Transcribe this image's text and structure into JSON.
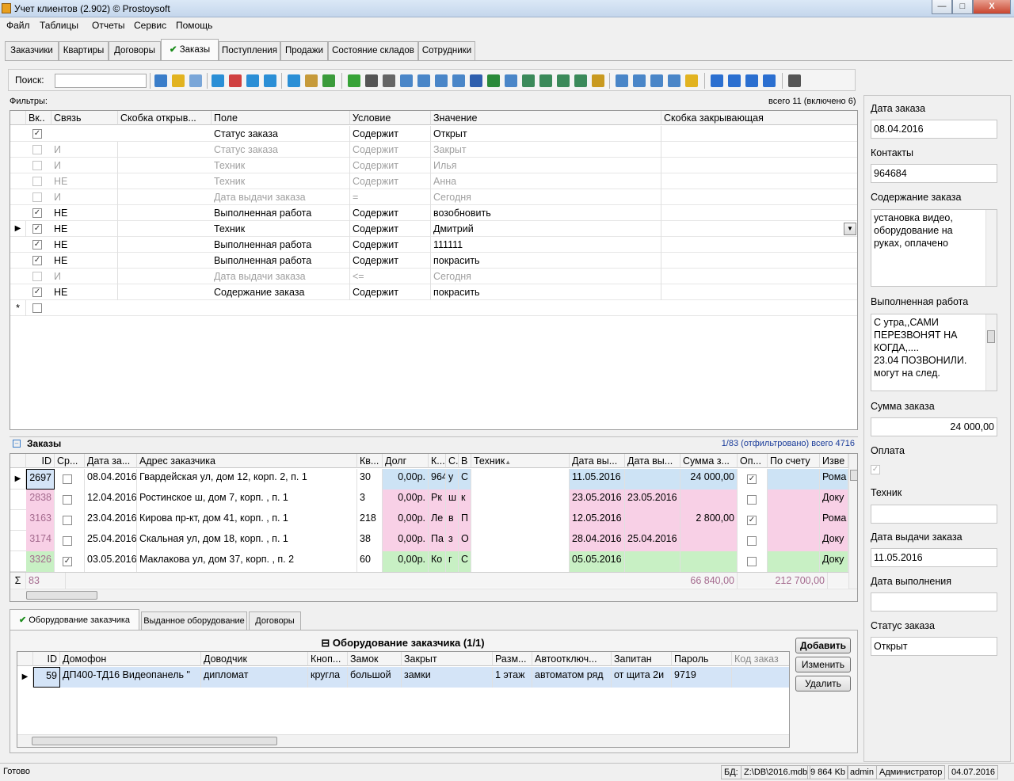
{
  "window": {
    "title": "Учет клиентов (2.902) © Prostoysoft",
    "minimize": "—",
    "maximize": "□",
    "close": "X"
  },
  "menu": [
    "Файл",
    "Таблицы",
    "Отчеты",
    "Сервис",
    "Помощь"
  ],
  "tabs": [
    {
      "label": "Заказчики"
    },
    {
      "label": "Квартиры"
    },
    {
      "label": "Договоры"
    },
    {
      "label": "Заказы",
      "active": true,
      "check": "✔"
    },
    {
      "label": "Поступления"
    },
    {
      "label": "Продажи"
    },
    {
      "label": "Состояние складов"
    },
    {
      "label": "Сотрудники"
    }
  ],
  "toolbar": {
    "search_label": "Поиск:",
    "search_value": "",
    "search_placeholder": ""
  },
  "filters": {
    "label": "Фильтры:",
    "summary": "всего 11 (включено 6)",
    "columns": [
      "Вк..",
      "Связь",
      "Скобка открыв...",
      "Поле",
      "Условие",
      "Значение",
      "Скобка закрывающая"
    ],
    "rows": [
      {
        "on": true,
        "link": "",
        "field": "Статус заказа",
        "cond": "Содержит",
        "value": "Открыт"
      },
      {
        "on": false,
        "link": "И",
        "field": "Статус заказа",
        "cond": "Содержит",
        "value": "Закрыт"
      },
      {
        "on": false,
        "link": "И",
        "field": "Техник",
        "cond": "Содержит",
        "value": "Илья"
      },
      {
        "on": false,
        "link": "НЕ",
        "field": "Техник",
        "cond": "Содержит",
        "value": "Анна"
      },
      {
        "on": false,
        "link": "И",
        "field": "Дата выдачи заказа",
        "cond": "=",
        "value": "Сегодня"
      },
      {
        "on": true,
        "link": "НЕ",
        "field": "Выполненная работа",
        "cond": "Содержит",
        "value": "возобновить"
      },
      {
        "on": true,
        "link": "НЕ",
        "field": "Техник",
        "cond": "Содержит",
        "value": "Дмитрий",
        "current": true
      },
      {
        "on": true,
        "link": "НЕ",
        "field": "Выполненная работа",
        "cond": "Содержит",
        "value": "111111"
      },
      {
        "on": true,
        "link": "НЕ",
        "field": "Выполненная работа",
        "cond": "Содержит",
        "value": "покрасить"
      },
      {
        "on": false,
        "link": "И",
        "field": "Дата выдачи заказа",
        "cond": "<=",
        "value": "Сегодня"
      },
      {
        "on": true,
        "link": "НЕ",
        "field": "Содержание заказа",
        "cond": "Содержит",
        "value": "покрасить"
      }
    ],
    "new_row_marker": "*"
  },
  "orders": {
    "title": "Заказы",
    "summary": "1/83 (отфильтровано) всего 4716",
    "columns": [
      "ID",
      "Ср...",
      "Дата за...",
      "Адрес заказчика",
      "Кв...",
      "Долг",
      "К...",
      "С.",
      "В",
      "Техник",
      "Дата вы...",
      "Дата вы...",
      "Сумма з...",
      "Оп...",
      "По счету",
      "Изве"
    ],
    "sort_marker": "▲",
    "rows": [
      {
        "id": "2697",
        "urgent": false,
        "date": "08.04.2016",
        "address": "Гвардейская ул, дом 12, корп. 2, п. 1",
        "apt": "30",
        "debt": "0,00р.",
        "k": "964",
        "s": "у",
        "v": "С",
        "tech": "",
        "issue": "11.05.2016",
        "issue2": "",
        "sum": "24 000,00",
        "paid": true,
        "bill": "",
        "info": "Рома",
        "color": "blue"
      },
      {
        "id": "2838",
        "urgent": false,
        "date": "12.04.2016",
        "address": "Ростинское ш, дом 7, корп. , п. 1",
        "apt": "3",
        "debt": "0,00р.",
        "k": "Рк",
        "s": "ш",
        "v": "к",
        "tech": "",
        "issue": "23.05.2016",
        "issue2": "23.05.2016",
        "sum": "",
        "paid": false,
        "bill": "",
        "info": "Доку",
        "color": "pink"
      },
      {
        "id": "3163",
        "urgent": false,
        "date": "23.04.2016",
        "address": "Кирова пр-кт, дом 41, корп. , п. 1",
        "apt": "218",
        "debt": "0,00р.",
        "k": "Ле",
        "s": "в",
        "v": "П",
        "tech": "",
        "issue": "12.05.2016",
        "issue2": "",
        "sum": "2 800,00",
        "paid": true,
        "bill": "",
        "info": "Рома",
        "color": "pink"
      },
      {
        "id": "3174",
        "urgent": false,
        "date": "25.04.2016",
        "address": "Скальная ул, дом 18, корп. , п. 1",
        "apt": "38",
        "debt": "0,00р.",
        "k": "Па",
        "s": "з",
        "v": "О",
        "tech": "",
        "issue": "28.04.2016",
        "issue2": "25.04.2016",
        "sum": "",
        "paid": false,
        "bill": "",
        "info": "Доку",
        "color": "pink"
      },
      {
        "id": "3326",
        "urgent": true,
        "date": "03.05.2016",
        "address": "Маклакова ул, дом 37, корп. , п. 2",
        "apt": "60",
        "debt": "0,00р.",
        "k": "Ко",
        "s": "г",
        "v": "С",
        "tech": "",
        "issue": "05.05.2016",
        "issue2": "",
        "sum": "",
        "paid": false,
        "bill": "",
        "info": "Доку",
        "color": "green"
      }
    ],
    "totals": {
      "sigma": "Σ",
      "count": "83",
      "sum": "66 840,00",
      "bill": "212 700,00"
    }
  },
  "bottom_tabs": [
    {
      "label": "Оборудование заказчика",
      "active": true,
      "check": "✔"
    },
    {
      "label": "Выданное оборудование"
    },
    {
      "label": "Договоры"
    }
  ],
  "equipment": {
    "title": "Оборудование заказчика (1/1)",
    "collapse": "⊟",
    "columns": [
      "ID",
      "Домофон",
      "Доводчик",
      "Кноп...",
      "Замок",
      "Закрыт",
      "Разм...",
      "Автоотключ...",
      "Запитан",
      "Пароль",
      "Код заказ"
    ],
    "rows": [
      {
        "id": "59",
        "intercom": "ДП400-ТД16 Видеопанель \"",
        "closer": "дипломат",
        "button": "кругла",
        "lock": "большой",
        "closed": "замки",
        "size": "1 этаж",
        "auto": "автоматом ряд",
        "power": "от щита 2и",
        "password": "9719",
        "code": ""
      }
    ],
    "buttons": {
      "add": "Добавить",
      "edit": "Изменить",
      "delete": "Удалить"
    }
  },
  "details": {
    "order_date_label": "Дата заказа",
    "order_date": "08.04.2016",
    "contacts_label": "Контакты",
    "contacts": "964684",
    "content_label": "Содержание заказа",
    "content_lines": [
      "установка видео,",
      "оборудование на",
      "руках, оплачено"
    ],
    "work_label": "Выполненная работа",
    "work_lines": [
      "С утра,,САМИ",
      "ПЕРЕЗВОНЯТ НА",
      "КОГДА,....",
      "23.04 ПОЗВОНИЛИ.",
      "могут на след."
    ],
    "sum_label": "Сумма заказа",
    "sum": "24 000,00",
    "paid_label": "Оплата",
    "tech_label": "Техник",
    "tech": "",
    "issue_label": "Дата выдачи заказа",
    "issue": "11.05.2016",
    "done_label": "Дата выполнения",
    "done": "",
    "status_label": "Статус заказа",
    "status": "Открыт"
  },
  "status": {
    "left": "Готово",
    "db_label": "БД:",
    "db_path": "Z:\\DB\\2016.mdb",
    "size": "9 864 Kb",
    "user": "admin",
    "role": "Администратор",
    "date": "04.07.2016"
  },
  "colors": {
    "blue": "#cde3f5",
    "pink": "#f8d0e6",
    "green": "#c8f0c4",
    "selected": "#d4e4f7"
  }
}
